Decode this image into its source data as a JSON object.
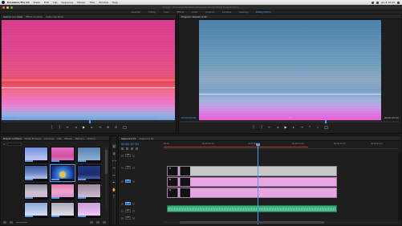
{
  "menubar": {
    "app_name": "Premiere Pro CC",
    "items": [
      "Файл",
      "Edit",
      "Clip",
      "Sequence",
      "Marker",
      "Title",
      "Window",
      "Help"
    ],
    "clock": "Jan 8 10:29"
  },
  "titlebar": {
    "path": "/Users/.../Documents/Adobe/Premiere Pro/Untitled Project.prproj"
  },
  "workspaces": [
    "Assembly",
    "Editing",
    "Color",
    "Effects",
    "Audio",
    "Graphics",
    "Libraries",
    "Learning",
    "Editing (CS5.5)"
  ],
  "active_workspace": "Editing (CS5.5)",
  "source_monitor": {
    "tabs": [
      "Source: (no clips)",
      "Effect Controls",
      "Audio Clip Mixer"
    ],
    "timecode_in": "00:00:00:00",
    "fit": "Fit",
    "timecode_out": "00:00:05:00"
  },
  "program_monitor": {
    "tabs": [
      "Program: Sequence 01"
    ],
    "timecode_in": "00:00:00:00",
    "fit": "Fit",
    "timecode_out": "00:00:05:00"
  },
  "transport_icons": [
    "mark-in-icon",
    "mark-out-icon",
    "go-to-in-icon",
    "step-back-icon",
    "play-icon",
    "step-forward-icon",
    "go-to-out-icon",
    "insert-icon",
    "overwrite-icon",
    "export-frame-icon"
  ],
  "project": {
    "tabs": [
      "Project: Untitled",
      "Media Browser",
      "Libraries",
      "Info",
      "Effects",
      "Markers",
      "History"
    ],
    "search_placeholder": "",
    "bottom_icons": [
      "list-view-icon",
      "icon-view-icon",
      "zoom-slider",
      "new-bin-icon",
      "new-item-icon",
      "delete-icon"
    ]
  },
  "thumbs": [
    {
      "name": "clip-01",
      "bg": "linear-gradient(180deg,#6f8fe0,#a6b8ea 60%,#c7c8ef)"
    },
    {
      "name": "clip-02",
      "bg": "linear-gradient(180deg,#e06ec8,#d24f9e 60%,#d58ad8)"
    },
    {
      "name": "clip-03",
      "bg": "linear-gradient(180deg,#5a7fae,#7aa2c8 60%,#9bb8d8)"
    },
    {
      "name": "clip-04",
      "bg": "linear-gradient(180deg,#3c5ea0,#6a88c8 50%,#d0d6ee)"
    },
    {
      "name": "clip-05",
      "bg": "radial-gradient(circle at 50% 60%,#f0c04a 0 18%,#2e8ee8 30%,#1c2c88 80%)"
    },
    {
      "name": "clip-06",
      "bg": "linear-gradient(180deg,#203a88,#1a2c6a 60%,#5a78c6)"
    },
    {
      "name": "clip-07",
      "bg": "linear-gradient(180deg,#8a8a9a,#c8c2d0 50%,#e0b0d6)"
    },
    {
      "name": "clip-08",
      "bg": "linear-gradient(180deg,#e07ab8,#f2a6c8 50%,#c98ad8)"
    },
    {
      "name": "clip-09",
      "bg": "linear-gradient(180deg,#9c8aa0,#b8a4ba 50%,#d8c0d4)"
    },
    {
      "name": "clip-10",
      "bg": "linear-gradient(180deg,#8aa8d8,#b4c6ea 50%,#e0e6f6)"
    },
    {
      "name": "clip-11",
      "bg": "linear-gradient(180deg,#a8a8b8,#cacad8 50%,#e8e8f0)"
    },
    {
      "name": "clip-12",
      "bg": "linear-gradient(180deg,#c8a0d8,#e0b4ea 50%,#f2d2f4)"
    }
  ],
  "tools": [
    "selection-tool-icon",
    "track-select-tool-icon",
    "ripple-edit-tool-icon",
    "razor-tool-icon",
    "slip-tool-icon",
    "pen-tool-icon",
    "hand-tool-icon",
    "type-tool-icon"
  ],
  "timeline": {
    "tabs": [
      "Sequence 01",
      "Sequence 02"
    ],
    "timecode": "00:00:07:10",
    "ruler_ticks": [
      "00:00",
      "00:00:04:23",
      "00:00:09:23",
      "00:00:14:23",
      "00:00:19:23",
      "00:00:24:23"
    ],
    "video_tracks": [
      "V3",
      "V2",
      "V1"
    ],
    "audio_tracks": [
      "A1",
      "A2",
      "A3"
    ],
    "clips": [
      {
        "name": "clip-gray-top",
        "label": "fx",
        "track": "V3"
      },
      {
        "name": "clip-pink-mid",
        "label": "fx",
        "track": "V2"
      },
      {
        "name": "clip-pink-low",
        "label": "fx",
        "track": "V1"
      },
      {
        "name": "clip-audio-a1",
        "label": "",
        "track": "A1"
      }
    ]
  },
  "colors": {
    "accent_blue": "#4d9ef5",
    "clip_pink": "#e5a6e3",
    "clip_gray": "#c7c7c7",
    "audio_green": "#3aa87a",
    "work_area_red": "#c0392b"
  }
}
